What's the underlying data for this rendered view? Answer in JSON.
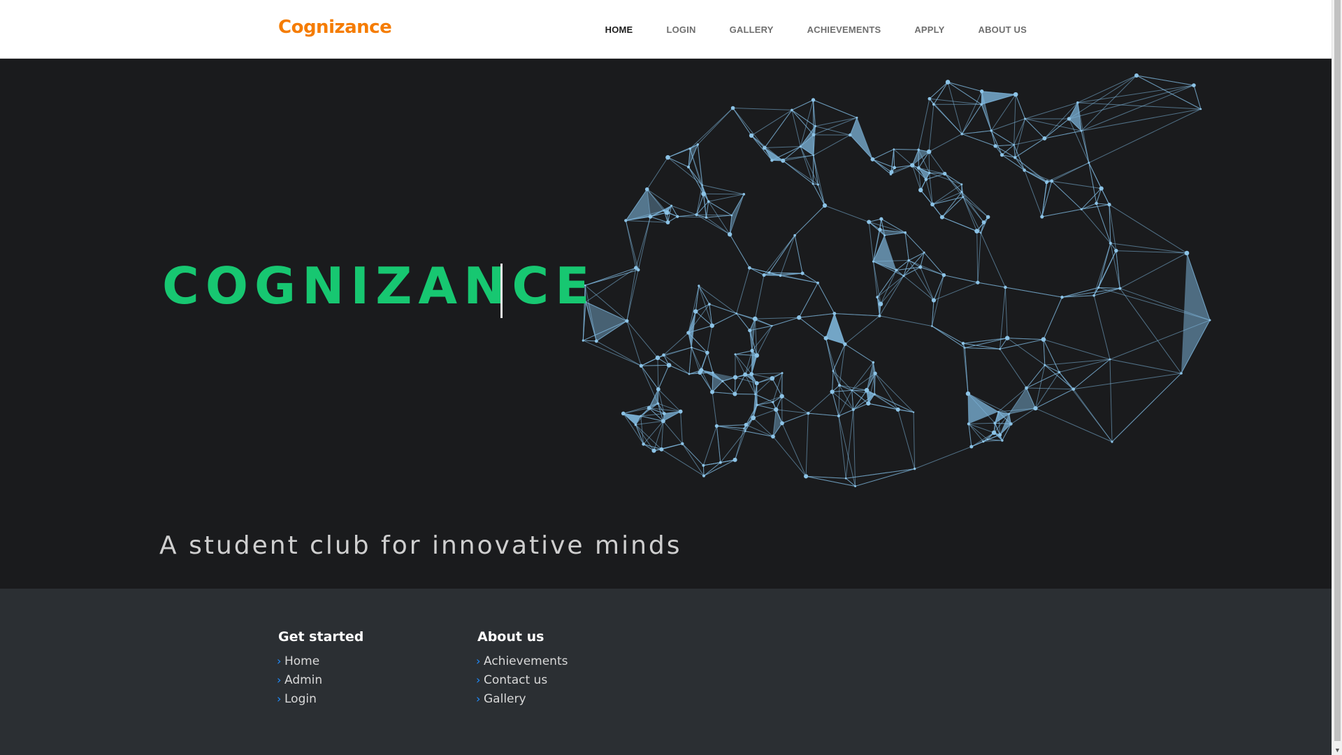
{
  "brand": "Cognizance",
  "nav": {
    "items": [
      {
        "label": "HOME",
        "active": true
      },
      {
        "label": "LOGIN"
      },
      {
        "label": "GALLERY"
      },
      {
        "label": "ACHIEVEMENTS"
      },
      {
        "label": "APPLY"
      },
      {
        "label": "ABOUT US"
      }
    ]
  },
  "hero": {
    "title": "COGNIZANCE",
    "subtitle": "A student club for innovative minds"
  },
  "footer": {
    "col1": {
      "heading": "Get started",
      "links": [
        "Home",
        "Admin",
        "Login"
      ]
    },
    "col2": {
      "heading": "About us",
      "links": [
        "Achievements",
        "Contact us",
        "Gallery"
      ]
    }
  },
  "colors": {
    "brand": "#f57c00",
    "hero_title": "#17c771",
    "network": "#7fb8de",
    "footer_bg": "#2b2f33",
    "link_chevron": "#1e8cff"
  },
  "icons": {
    "link_bullet": "chevron-right-icon"
  }
}
